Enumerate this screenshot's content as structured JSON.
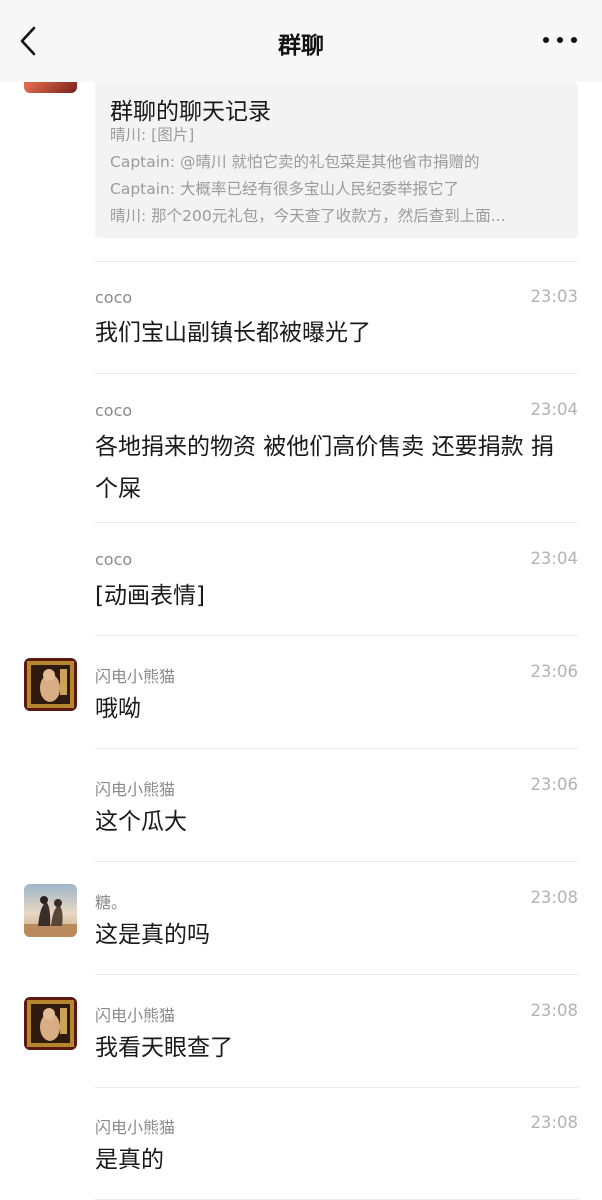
{
  "header": {
    "title": "群聊",
    "back_icon": "chevron-left-icon",
    "more_icon": "more-dots-icon"
  },
  "record_card": {
    "title": "群聊的聊天记录",
    "lines": [
      "晴川: [图片]",
      "Captain: @晴川 就怕它卖的礼包菜是其他省市捐赠的",
      "Captain: 大概率已经有很多宝山人民纪委举报它了",
      "晴川: 那个200元礼包，今天查了收款方，然后查到上面..."
    ]
  },
  "messages": [
    {
      "sender": "coco",
      "time": "23:03",
      "text": "我们宝山副镇长都被曝光了",
      "avatar": ""
    },
    {
      "sender": "coco",
      "time": "23:04",
      "text": "各地捐来的物资  被他们高价售卖  还要捐款  捐个屎",
      "avatar": ""
    },
    {
      "sender": "coco",
      "time": "23:04",
      "text": "[动画表情]",
      "avatar": ""
    },
    {
      "sender": "闪电小熊猫",
      "time": "23:06",
      "text": "哦呦",
      "avatar": "painting"
    },
    {
      "sender": "闪电小熊猫",
      "time": "23:06",
      "text": "这个瓜大",
      "avatar": ""
    },
    {
      "sender": "糖。",
      "time": "23:08",
      "text": "这是真的吗",
      "avatar": "photo"
    },
    {
      "sender": "闪电小熊猫",
      "time": "23:08",
      "text": "我看天眼查了",
      "avatar": "painting"
    },
    {
      "sender": "闪电小熊猫",
      "time": "23:08",
      "text": "是真的",
      "avatar": ""
    }
  ],
  "colors": {
    "nav_background": "#f7f7f7",
    "card_background": "#f3f3f3",
    "divider": "#e8e8e8",
    "meta_text": "#8a8a8a",
    "time_text": "#b3b3b3"
  }
}
